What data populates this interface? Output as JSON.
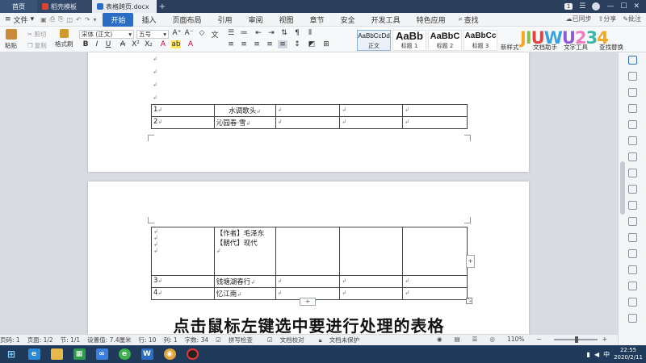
{
  "tabs": [
    {
      "label": "首页"
    },
    {
      "label": "稻壳模板"
    },
    {
      "label": "表格跨页.docx"
    }
  ],
  "window": {
    "page_badge": "1"
  },
  "menu": {
    "file": "文件",
    "items": [
      "开始",
      "插入",
      "页面布局",
      "引用",
      "审阅",
      "视图",
      "章节",
      "安全",
      "开发工具",
      "特色应用"
    ],
    "search": "查找",
    "sync": "已同步",
    "share": "分享",
    "comment": "批注"
  },
  "ribbon": {
    "paste": "粘贴",
    "cut": "剪切",
    "copy": "复制",
    "format_painter": "格式刷",
    "font_name": "宋体 (正文)",
    "font_size": "五号",
    "styles": [
      {
        "preview": "AaBbCcDd",
        "label": "正文"
      },
      {
        "preview": "AaBb",
        "label": "标题 1"
      },
      {
        "preview": "AaBbC",
        "label": "标题 2"
      },
      {
        "preview": "AaBbCc",
        "label": "标题 3"
      }
    ],
    "new_style": "新样式",
    "doc_assistant": "文档助手",
    "text_tools": "文字工具",
    "find_replace": "查找替换"
  },
  "logo": {
    "text": "JIUWU234"
  },
  "document": {
    "table1": {
      "rows": [
        {
          "num": "1",
          "title": "水调歌头"
        },
        {
          "num": "2",
          "title": "沁园春·雪"
        }
      ]
    },
    "table2": {
      "author": "【作者】毛泽东",
      "dynasty": "【朝代】现代",
      "rows": [
        {
          "num": "3",
          "title": "钱塘湖春行"
        },
        {
          "num": "4",
          "title": "忆江南"
        }
      ]
    }
  },
  "subtitle": "点击鼠标左键选中要进行处理的表格",
  "statusbar": {
    "pages": "页码: 1",
    "page_of": "页面: 1/2",
    "section": "节: 1/1",
    "position": "设置值: 7.4厘米",
    "row": "行: 10",
    "col": "列: 1",
    "words": "字数: 34",
    "spell": "拼写检查",
    "proof": "文档校对",
    "protect": "文档未保护",
    "zoom": "110%"
  },
  "taskbar": {
    "time": "22:55",
    "date": "2020/2/11",
    "ime": "中"
  }
}
